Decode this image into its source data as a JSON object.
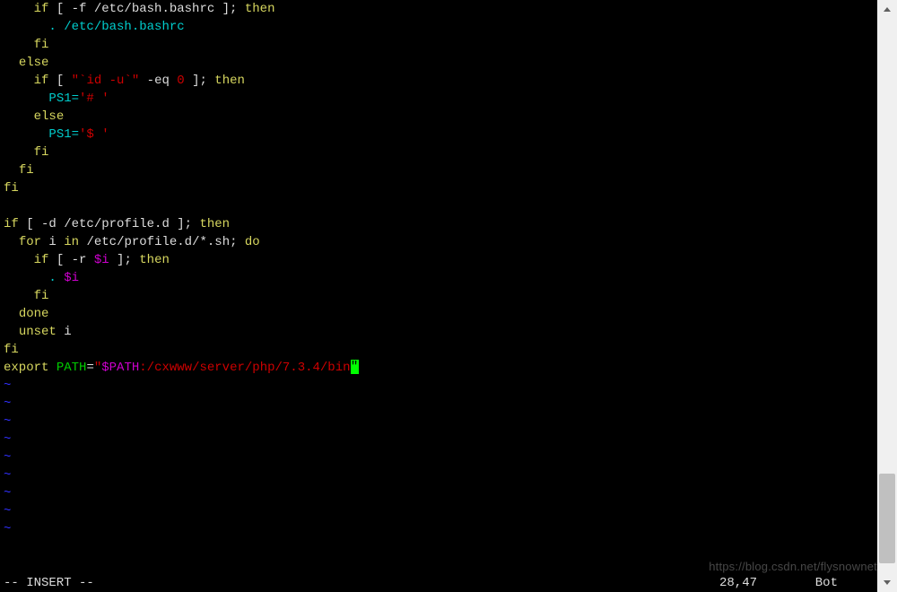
{
  "lines": [
    {
      "indent": "    ",
      "tokens": [
        {
          "t": "if",
          "c": "kw-yellow"
        },
        {
          "t": " [ -f /etc/bash.bashrc ]; ",
          "c": ""
        },
        {
          "t": "then",
          "c": "kw-yellow"
        }
      ]
    },
    {
      "indent": "      ",
      "tokens": [
        {
          "t": ". /etc/bash.bashrc",
          "c": "cyan"
        }
      ]
    },
    {
      "indent": "    ",
      "tokens": [
        {
          "t": "fi",
          "c": "kw-yellow"
        }
      ]
    },
    {
      "indent": "  ",
      "tokens": [
        {
          "t": "else",
          "c": "kw-yellow"
        }
      ]
    },
    {
      "indent": "    ",
      "tokens": [
        {
          "t": "if",
          "c": "kw-yellow"
        },
        {
          "t": " [ ",
          "c": ""
        },
        {
          "t": "\"`id -u`\"",
          "c": "red"
        },
        {
          "t": " -eq ",
          "c": ""
        },
        {
          "t": "0",
          "c": "red"
        },
        {
          "t": " ]; ",
          "c": ""
        },
        {
          "t": "then",
          "c": "kw-yellow"
        }
      ]
    },
    {
      "indent": "      ",
      "tokens": [
        {
          "t": "PS1=",
          "c": "cyan"
        },
        {
          "t": "'# '",
          "c": "red"
        }
      ]
    },
    {
      "indent": "    ",
      "tokens": [
        {
          "t": "else",
          "c": "kw-yellow"
        }
      ]
    },
    {
      "indent": "      ",
      "tokens": [
        {
          "t": "PS1=",
          "c": "cyan"
        },
        {
          "t": "'$ '",
          "c": "red"
        }
      ]
    },
    {
      "indent": "    ",
      "tokens": [
        {
          "t": "fi",
          "c": "kw-yellow"
        }
      ]
    },
    {
      "indent": "  ",
      "tokens": [
        {
          "t": "fi",
          "c": "kw-yellow"
        }
      ]
    },
    {
      "indent": "",
      "tokens": [
        {
          "t": "fi",
          "c": "kw-yellow"
        }
      ]
    },
    {
      "indent": "",
      "tokens": []
    },
    {
      "indent": "",
      "tokens": [
        {
          "t": "if",
          "c": "kw-yellow"
        },
        {
          "t": " [ -d /etc/profile.d ]; ",
          "c": ""
        },
        {
          "t": "then",
          "c": "kw-yellow"
        }
      ]
    },
    {
      "indent": "  ",
      "tokens": [
        {
          "t": "for",
          "c": "kw-yellow"
        },
        {
          "t": " i ",
          "c": ""
        },
        {
          "t": "in",
          "c": "kw-yellow"
        },
        {
          "t": " /etc/profile.d/*.sh; ",
          "c": ""
        },
        {
          "t": "do",
          "c": "kw-yellow"
        }
      ]
    },
    {
      "indent": "    ",
      "tokens": [
        {
          "t": "if",
          "c": "kw-yellow"
        },
        {
          "t": " [ -r ",
          "c": ""
        },
        {
          "t": "$i",
          "c": "magenta"
        },
        {
          "t": " ]; ",
          "c": ""
        },
        {
          "t": "then",
          "c": "kw-yellow"
        }
      ]
    },
    {
      "indent": "      ",
      "tokens": [
        {
          "t": ". ",
          "c": "cyan"
        },
        {
          "t": "$i",
          "c": "magenta"
        }
      ]
    },
    {
      "indent": "    ",
      "tokens": [
        {
          "t": "fi",
          "c": "kw-yellow"
        }
      ]
    },
    {
      "indent": "  ",
      "tokens": [
        {
          "t": "done",
          "c": "kw-yellow"
        }
      ]
    },
    {
      "indent": "  ",
      "tokens": [
        {
          "t": "unset",
          "c": "kw-yellow"
        },
        {
          "t": " i",
          "c": ""
        }
      ]
    },
    {
      "indent": "",
      "tokens": [
        {
          "t": "fi",
          "c": "kw-yellow"
        }
      ]
    },
    {
      "indent": "",
      "tokens": [
        {
          "t": "export",
          "c": "kw-yellow"
        },
        {
          "t": " ",
          "c": ""
        },
        {
          "t": "PATH",
          "c": "green"
        },
        {
          "t": "=",
          "c": ""
        },
        {
          "t": "\"",
          "c": "red"
        },
        {
          "t": "$PATH",
          "c": "magenta"
        },
        {
          "t": ":/cxwww/server/php/7.3.4/bin",
          "c": "red"
        },
        {
          "cursor": true,
          "t": "\""
        }
      ]
    }
  ],
  "empty_tilde_lines": 9,
  "tilde_char": "~",
  "status": {
    "mode": "-- INSERT --",
    "position": "28,47",
    "scroll": "Bot"
  },
  "watermark": "https://blog.csdn.net/flysnownet"
}
